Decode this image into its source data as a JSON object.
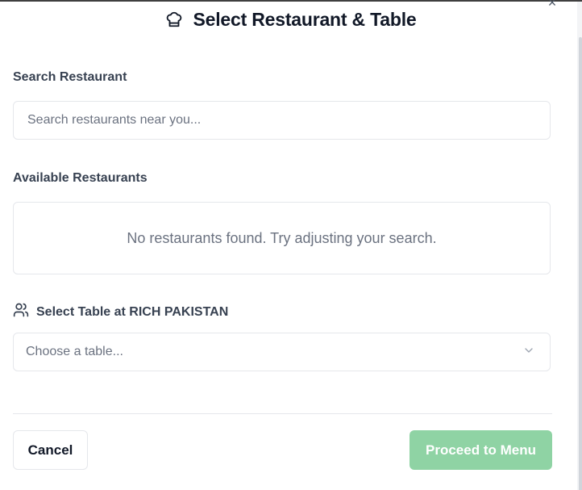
{
  "dialog": {
    "title": "Select Restaurant & Table",
    "title_icon": "chef-hat-icon",
    "close_icon": "close-icon",
    "close_glyph": "×"
  },
  "search": {
    "label": "Search Restaurant",
    "placeholder": "Search restaurants near you...",
    "value": ""
  },
  "restaurants": {
    "label": "Available Restaurants",
    "empty_message": "No restaurants found. Try adjusting your search.",
    "items": []
  },
  "table": {
    "icon": "users-icon",
    "label": "Select Table at RICH PAKISTAN",
    "selected_value": "Choose a table...",
    "chevron_icon": "chevron-down-icon"
  },
  "footer": {
    "cancel_label": "Cancel",
    "proceed_label": "Proceed to Menu",
    "proceed_color": "#8fd3a4"
  }
}
